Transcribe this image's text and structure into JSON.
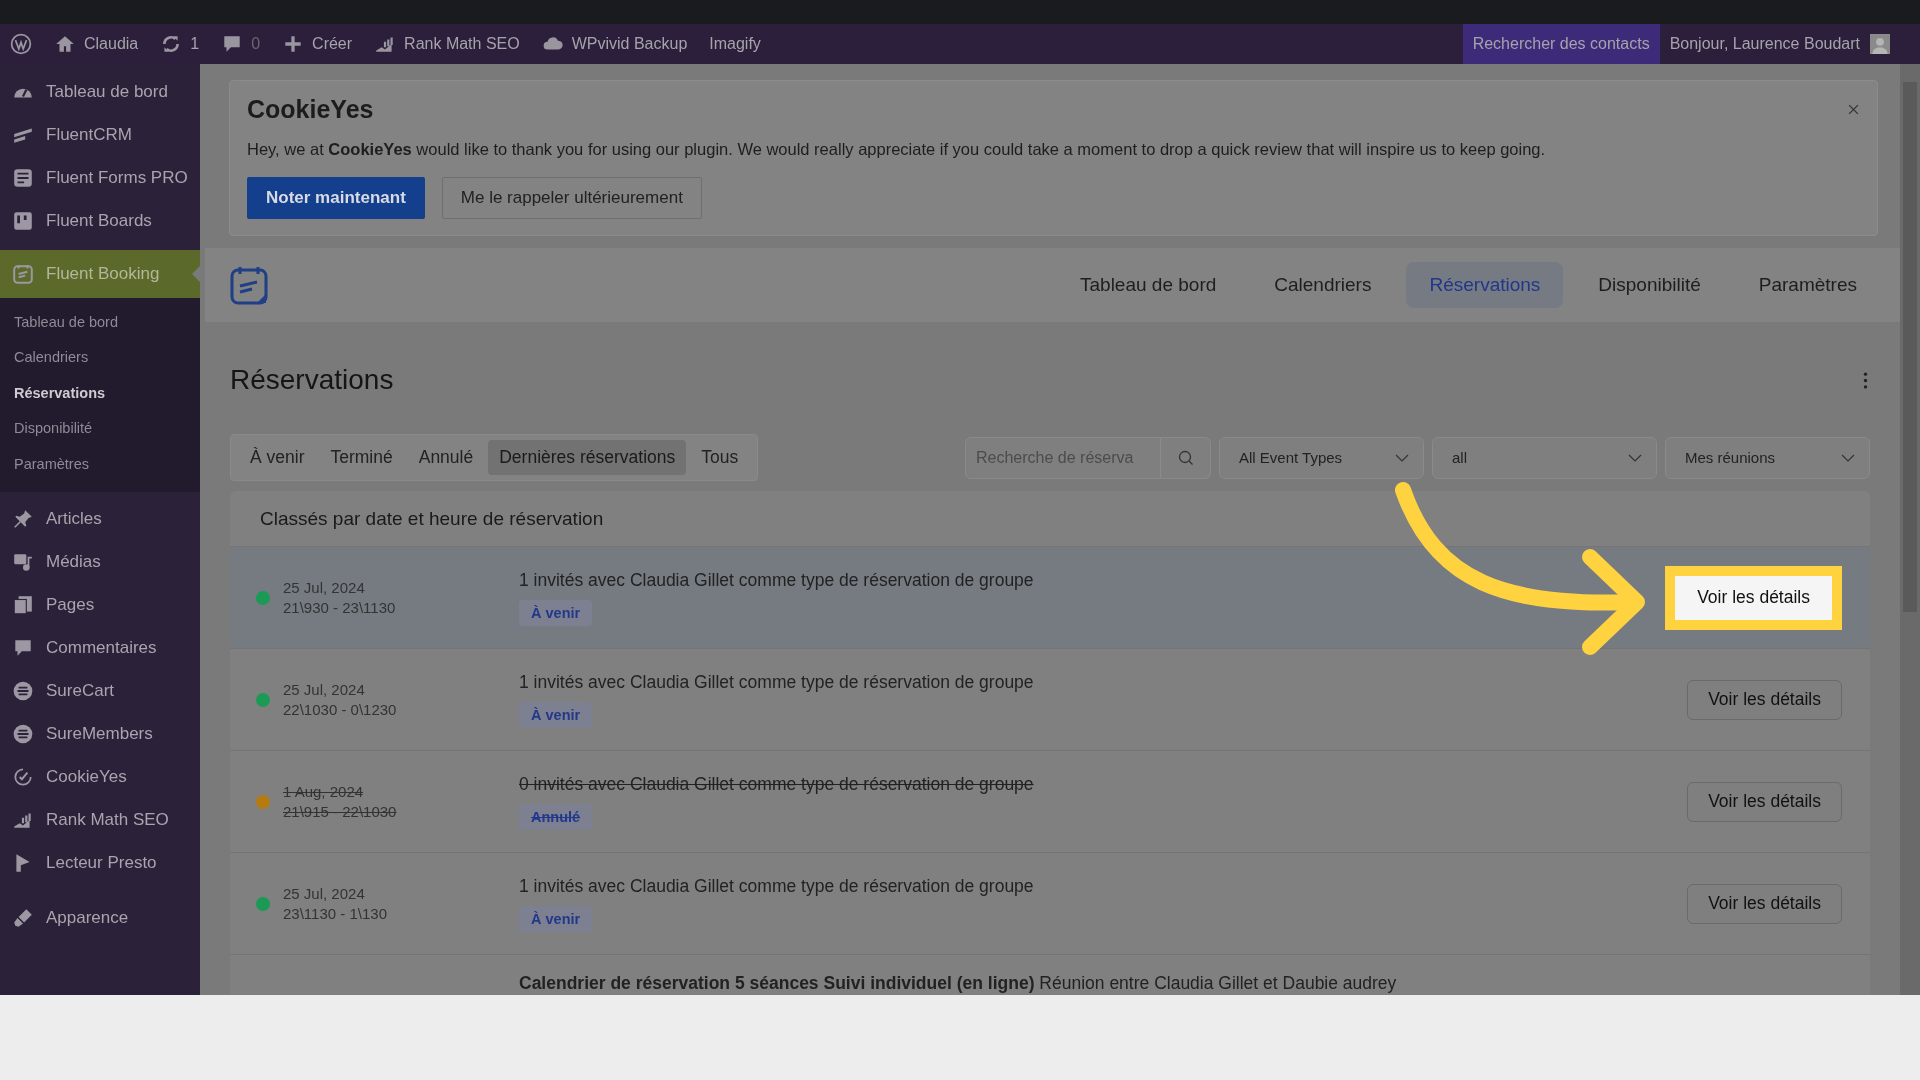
{
  "admin_bar": {
    "site": "Claudia",
    "updates": "1",
    "comments": "0",
    "new": "Créer",
    "items": [
      "Rank Math SEO",
      "WPvivid Backup",
      "Imagify"
    ],
    "search": "Rechercher des contacts",
    "greeting": "Bonjour, Laurence Boudart"
  },
  "sidebar": {
    "items": [
      {
        "label": "Tableau de bord",
        "selected": false
      },
      {
        "label": "FluentCRM",
        "selected": false
      },
      {
        "label": "Fluent Forms PRO",
        "selected": false
      },
      {
        "label": "Fluent Boards",
        "selected": false
      },
      {
        "label": "Fluent Booking",
        "selected": true,
        "children": [
          {
            "label": "Tableau de bord",
            "selected": false
          },
          {
            "label": "Calendriers",
            "selected": false
          },
          {
            "label": "Réservations",
            "selected": true
          },
          {
            "label": "Disponibilité",
            "selected": false
          },
          {
            "label": "Paramètres",
            "selected": false
          }
        ]
      },
      {
        "label": "Articles",
        "selected": false
      },
      {
        "label": "Médias",
        "selected": false
      },
      {
        "label": "Pages",
        "selected": false
      },
      {
        "label": "Commentaires",
        "selected": false
      },
      {
        "label": "SureCart",
        "selected": false
      },
      {
        "label": "SureMembers",
        "selected": false
      },
      {
        "label": "CookieYes",
        "selected": false
      },
      {
        "label": "Rank Math SEO",
        "selected": false
      },
      {
        "label": "Lecteur Presto",
        "selected": false
      },
      {
        "label": "Apparence",
        "selected": false
      }
    ]
  },
  "notice": {
    "logo": "CookieYes",
    "message": "Hey, we at **CookieYes** would like to thank you for using our plugin. We would really appreciate if you could take a moment to drop a quick review that will inspire us to keep going.",
    "buttons": [
      "Noter maintenant",
      "Me le rappeler ultérieurement"
    ]
  },
  "app_nav": {
    "tabs": [
      {
        "label": "Tableau de bord",
        "selected": false
      },
      {
        "label": "Calendriers",
        "selected": false
      },
      {
        "label": "Réservations",
        "selected": true
      },
      {
        "label": "Disponibilité",
        "selected": false
      },
      {
        "label": "Paramètres",
        "selected": false
      }
    ]
  },
  "page": {
    "title": "Réservations",
    "filters": [
      {
        "label": "À venir",
        "selected": false
      },
      {
        "label": "Terminé",
        "selected": false
      },
      {
        "label": "Annulé",
        "selected": false
      },
      {
        "label": "Dernières réservations",
        "selected": true
      },
      {
        "label": "Tous",
        "selected": false
      }
    ],
    "search": {
      "placeholder": "Recherche de réserva"
    },
    "dropdowns": [
      "All Event Types",
      "all",
      "Mes réunions"
    ]
  },
  "list": {
    "heading": "Classés par date et heure de réservation",
    "rows": [
      {
        "date": "25 Jul, 2024",
        "time": "21\\930 - 23\\1130",
        "title": "1 invités avec Claudia Gillet comme type de réservation de groupe",
        "status": "À venir",
        "color": "#1a9a55",
        "cancelled": false,
        "selected": true,
        "button": "Voir les détails"
      },
      {
        "date": "25 Jul, 2024",
        "time": "22\\1030 - 0\\1230",
        "title": "1 invités avec Claudia Gillet comme type de réservation de groupe",
        "status": "À venir",
        "color": "#1a9a55",
        "cancelled": false,
        "selected": false,
        "button": "Voir les détails"
      },
      {
        "date": "1 Aug, 2024",
        "time": "21\\915 - 22\\1030",
        "title": "0 invités avec Claudia Gillet comme type de réservation de groupe",
        "status": "Annulé",
        "color": "#b57a10",
        "cancelled": true,
        "selected": false,
        "button": "Voir les détails"
      },
      {
        "date": "25 Jul, 2024",
        "time": "23\\1130 - 1\\130",
        "title": "1 invités avec Claudia Gillet comme type de réservation de groupe",
        "status": "À venir",
        "color": "#1a9a55",
        "cancelled": false,
        "selected": false,
        "button": "Voir les détails"
      },
      {
        "title": "**Calendrier de réservation 5 séances Suivi individuel (en ligne)** Réunion entre Claudia Gillet et Daubie audrey",
        "cancelled": false,
        "selected": false
      }
    ]
  }
}
